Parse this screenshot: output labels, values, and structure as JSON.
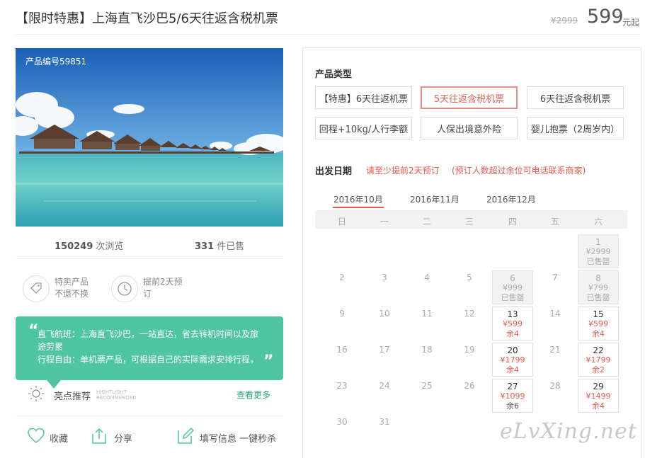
{
  "header": {
    "title": "【限时特惠】上海直飞沙巴5/6天往返含税机票",
    "old_price": "¥2999",
    "price": "599",
    "price_unit": "元起"
  },
  "product": {
    "number_label": "产品编号59851",
    "views_count": "150249",
    "views_label": "次浏览",
    "sold_count": "331",
    "sold_label": "件已售"
  },
  "features": [
    {
      "line1": "特卖产品",
      "line2": "不退不换",
      "icon": "tag-icon"
    },
    {
      "line1": "提前2天预",
      "line2": "订",
      "icon": "clock-icon"
    }
  ],
  "highlights": {
    "line1": "直飞航班：上海直飞沙巴，一站直达，省去转机时间以及旅",
    "line2": "途劳累",
    "line3": "行程自由：单机票产品，可根据自己的实际需求安排行程，",
    "open_quote": "“",
    "close_quote": "”",
    "label": "亮点推荐",
    "label_en1": "HIGHTLIGHT",
    "label_en2": "RECOMMENDED",
    "more": "查看更多"
  },
  "actions": {
    "favorite": "收藏",
    "share": "分享",
    "fill_info": "填写信息 一键秒杀"
  },
  "product_types": {
    "title": "产品类型",
    "options": [
      {
        "label": "【特惠】6天往返机票",
        "selected": false
      },
      {
        "label": "5天往返含税机票",
        "selected": true
      },
      {
        "label": "6天往返含税机票",
        "selected": false
      },
      {
        "label": "回程+10kg/人行李额",
        "selected": false
      },
      {
        "label": "人保出境意外险",
        "selected": false
      },
      {
        "label": "婴儿抱票（2周岁内）",
        "selected": false
      }
    ]
  },
  "departure": {
    "title": "出发日期",
    "note1": "请至少提前2天预订",
    "note2": "(预订人数超过余位可电话联系商家)",
    "months": [
      "2016年10月",
      "2016年11月",
      "2016年12月"
    ],
    "active_month": "2016年10月",
    "weekdays": [
      "日",
      "一",
      "二",
      "三",
      "四",
      "五",
      "六"
    ],
    "days": {
      "d1": {
        "day": "1",
        "price": "¥2999",
        "status": "已售罄"
      },
      "d2": "2",
      "d3": "3",
      "d4": "4",
      "d5": "5",
      "d6": {
        "day": "6",
        "price": "¥999",
        "status": "已售罄"
      },
      "d7": "7",
      "d8": {
        "day": "8",
        "price": "¥799",
        "status": "已售罄"
      },
      "d9": "9",
      "d10": "10",
      "d11": "11",
      "d12": "12",
      "d13": {
        "day": "13",
        "price": "¥599",
        "remain": "余4"
      },
      "d14": "14",
      "d15": {
        "day": "15",
        "price": "¥599",
        "remain": "余4"
      },
      "d16": "16",
      "d17": "17",
      "d18": "18",
      "d19": "19",
      "d20": {
        "day": "20",
        "price": "¥1799",
        "remain": "余4"
      },
      "d21": "21",
      "d22": {
        "day": "22",
        "price": "¥1799",
        "remain": "余2"
      },
      "d23": "23",
      "d24": "24",
      "d25": "25",
      "d26": "26",
      "d27": {
        "day": "27",
        "price": "¥1099",
        "remain": "余6"
      },
      "d28": "28",
      "d29": {
        "day": "29",
        "price": "¥1499",
        "remain": "余4"
      },
      "d30": "30",
      "d31": "31"
    }
  },
  "watermark": "eLvXing.net"
}
